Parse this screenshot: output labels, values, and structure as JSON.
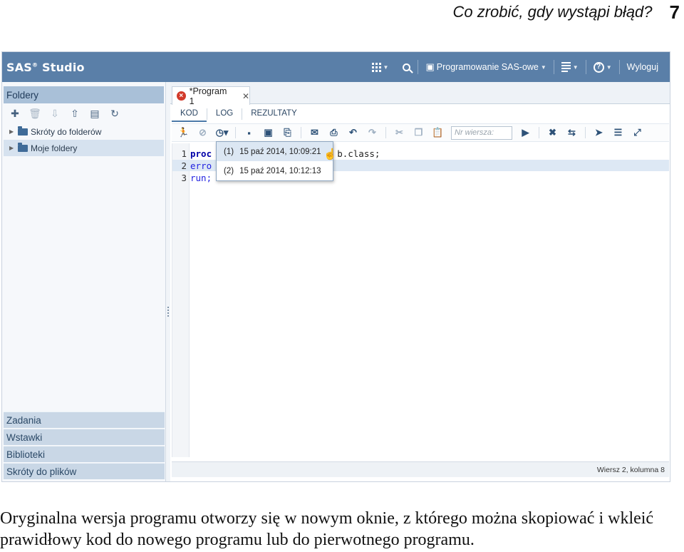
{
  "document": {
    "header_title": "Co zrobić, gdy wystąpi błąd?",
    "page_number": "7",
    "caption": "Oryginalna wersja programu otworzy się w nowym oknie, z którego można skopiować i wkleić prawidłowy kod do nowego programu lub do pierwotnego programu."
  },
  "app": {
    "brand": "SAS",
    "brand_suffix": "Studio",
    "brand_reg": "®",
    "topbar": {
      "apps_icon": "apps-grid-icon",
      "search_icon": "search-icon",
      "perspective_label": "Programowanie SAS-owe",
      "menu_icon": "hamburger-menu-icon",
      "help_icon": "help-icon",
      "logout_label": "Wyloguj"
    },
    "sidebar": {
      "folders_header": "Foldery",
      "tools": [
        "new-item-icon",
        "delete-icon",
        "download-icon",
        "upload-icon",
        "properties-icon",
        "refresh-icon"
      ],
      "tree": [
        {
          "label": "Skróty do folderów",
          "selected": false
        },
        {
          "label": "Moje foldery",
          "selected": true
        }
      ],
      "sections": [
        "Zadania",
        "Wstawki",
        "Biblioteki",
        "Skróty do plików"
      ]
    },
    "main": {
      "tab_label": "*Program 1",
      "sub_tabs": [
        {
          "label": "KOD",
          "active": true
        },
        {
          "label": "LOG",
          "active": false
        },
        {
          "label": "REZULTATY",
          "active": false
        }
      ],
      "line_placeholder": "Nr wiersza:",
      "code": [
        {
          "num": "1",
          "text": "proc",
          "rest": "                       b.class;",
          "highlight": false
        },
        {
          "num": "2",
          "text": "erro",
          "rest": "",
          "highlight": true
        },
        {
          "num": "3",
          "text": "run;",
          "rest": "",
          "highlight": false
        }
      ],
      "history_dropdown": [
        {
          "index": "(1)",
          "label": "15 paź 2014, 10:09:21",
          "hover": true
        },
        {
          "index": "(2)",
          "label": "15 paź 2014, 10:12:13",
          "hover": false
        }
      ],
      "status": "Wiersz 2, kolumna 8"
    }
  }
}
